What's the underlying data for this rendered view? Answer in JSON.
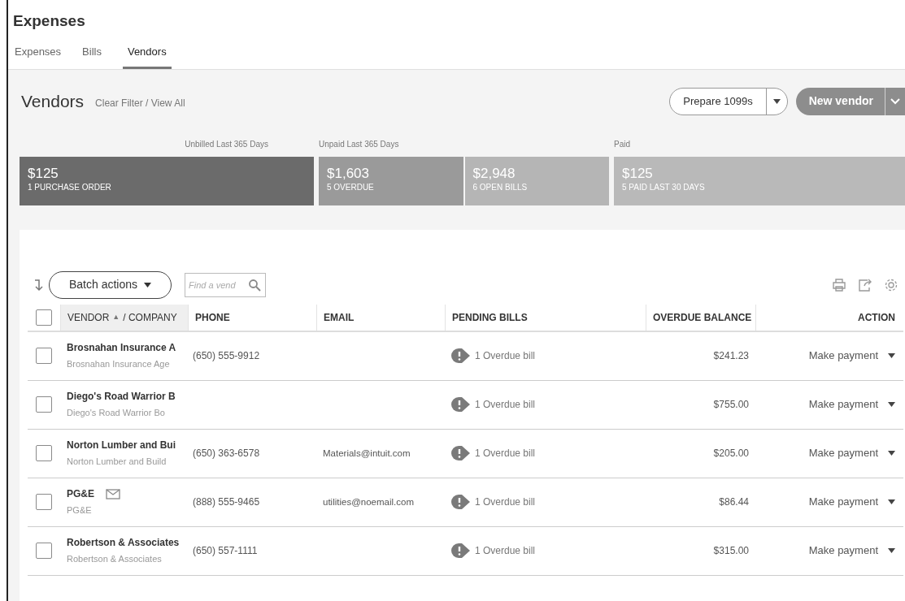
{
  "page_title": "Expenses",
  "tabs": [
    {
      "label": "Expenses",
      "selected": false
    },
    {
      "label": "Bills",
      "selected": false
    },
    {
      "label": "Vendors",
      "selected": true
    }
  ],
  "header": {
    "title": "Vendors",
    "filter_link": "Clear Filter / View All",
    "prepare_button": "Prepare 1099s",
    "new_button": "New vendor"
  },
  "summary": [
    {
      "label": "Unbilled Last 365 Days",
      "segments": [
        {
          "amount": "$125",
          "caption": "1 PURCHASE ORDER",
          "kind": "unbilled"
        }
      ]
    },
    {
      "label": "Unpaid Last 365 Days",
      "segments": [
        {
          "amount": "$1,603",
          "caption": "5 OVERDUE",
          "kind": "overdue"
        },
        {
          "amount": "$2,948",
          "caption": "6 OPEN BILLS",
          "kind": "open"
        }
      ]
    },
    {
      "label": "Paid",
      "segments": [
        {
          "amount": "$125",
          "caption": "5 PAID LAST 30 DAYS",
          "kind": "paid"
        }
      ]
    }
  ],
  "toolbar": {
    "batch_button": "Batch actions",
    "search": {
      "placeholder": "Find a vend"
    }
  },
  "table": {
    "select_all_checked": false,
    "columns": [
      {
        "label": "VENDOR",
        "sort": "▲",
        "suffix": "/ COMPANY",
        "sorted": true
      },
      {
        "label": "PHONE",
        "sorted": false
      },
      {
        "label": "EMAIL",
        "sorted": false
      },
      {
        "label": "PENDING BILLS",
        "sorted": false
      },
      {
        "label": "OVERDUE BALANCE",
        "sorted": false
      },
      {
        "label": "ACTION",
        "sorted": false
      }
    ],
    "rows": [
      {
        "checked": false,
        "vendor": "Brosnahan Insurance A",
        "company": "Brosnahan Insurance Age",
        "mail_icon": false,
        "phone": "(650) 555-9912",
        "pending": "1 Overdue bill",
        "overdue": "$241.23",
        "action": "Make payment"
      },
      {
        "checked": false,
        "vendor": "Diego's Road Warrior B",
        "company": "Diego's Road Warrior Bo",
        "mail_icon": false,
        "pending": "1 Overdue bill",
        "overdue": "$755.00",
        "action": "Make payment"
      },
      {
        "checked": false,
        "vendor": "Norton Lumber and Bui",
        "company": "Norton Lumber and Build",
        "mail_icon": false,
        "phone": "(650) 363-6578",
        "email": "Materials@intuit.com",
        "pending": "1 Overdue bill",
        "overdue": "$205.00",
        "action": "Make payment"
      },
      {
        "checked": false,
        "vendor": "PG&E",
        "company": "PG&E",
        "mail_icon": true,
        "phone": "(888) 555-9465",
        "email": "utilities@noemail.com",
        "pending": "1 Overdue bill",
        "overdue": "$86.44",
        "action": "Make payment"
      },
      {
        "checked": false,
        "vendor": "Robertson & Associates",
        "company": "Robertson & Associates",
        "mail_icon": false,
        "phone": "(650) 557-1111",
        "pending": "1 Overdue bill",
        "overdue": "$315.00",
        "action": "Make payment"
      }
    ]
  }
}
